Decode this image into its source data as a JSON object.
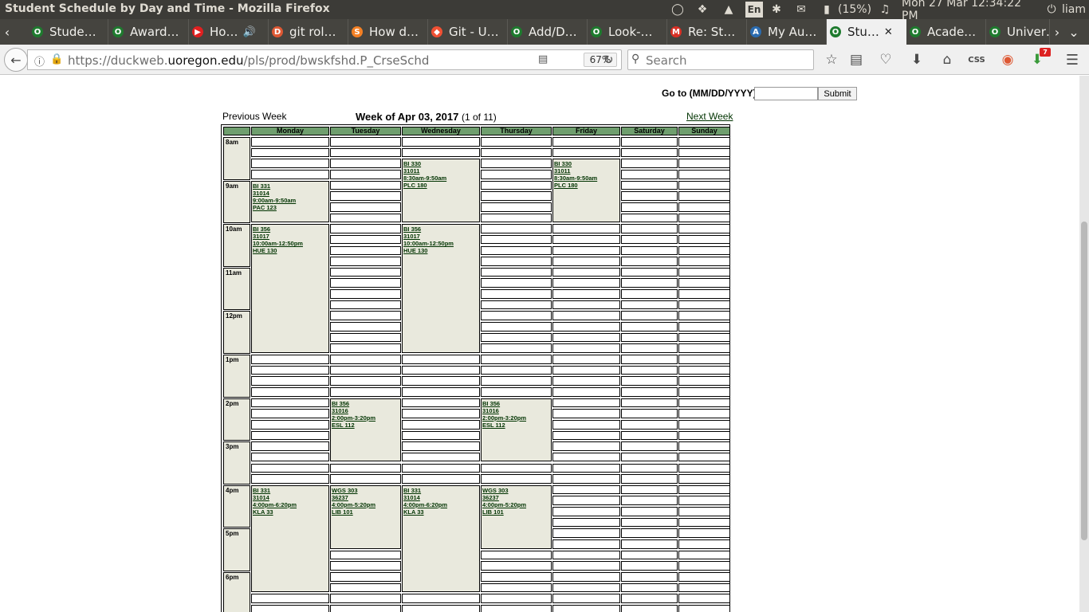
{
  "window": {
    "title": "Student Schedule by Day and Time - Mozilla Firefox"
  },
  "tray": {
    "lang": "En",
    "battery": "(15%)",
    "clock": "Mon 27 Mar 12:34:22 PM",
    "user": "liam",
    "icons": [
      "lightbulb-icon",
      "dropbox-icon",
      "wifi-icon",
      "keyboard-lang-icon",
      "bluetooth-icon",
      "mail-icon",
      "battery-icon",
      "volume-icon",
      "power-icon"
    ]
  },
  "tabs": [
    {
      "label": "Stude…",
      "favicon": "O",
      "favcolor": "#1e7b2e",
      "active": false
    },
    {
      "label": "Award…",
      "favicon": "O",
      "favcolor": "#1e7b2e",
      "active": false
    },
    {
      "label": "Ho…",
      "favicon": "▶",
      "favcolor": "#e02020",
      "active": false,
      "extra": "🔊"
    },
    {
      "label": "git rol…",
      "favicon": "D",
      "favcolor": "#de5833",
      "active": false
    },
    {
      "label": "How d…",
      "favicon": "S",
      "favcolor": "#f48024",
      "active": false
    },
    {
      "label": "Git - U…",
      "favicon": "◆",
      "favcolor": "#f05033",
      "active": false
    },
    {
      "label": "Add/D…",
      "favicon": "O",
      "favcolor": "#1e7b2e",
      "active": false
    },
    {
      "label": "Look-…",
      "favicon": "O",
      "favcolor": "#1e7b2e",
      "active": false
    },
    {
      "label": "Re: St…",
      "favicon": "M",
      "favcolor": "#d93025",
      "active": false
    },
    {
      "label": "My Au…",
      "favicon": "A",
      "favcolor": "#2b6cb0",
      "active": false
    },
    {
      "label": "Stu…",
      "favicon": "O",
      "favcolor": "#1e7b2e",
      "active": true,
      "extra": "✕"
    },
    {
      "label": "Acade…",
      "favicon": "O",
      "favcolor": "#1e7b2e",
      "active": false
    },
    {
      "label": "Univer…",
      "favicon": "O",
      "favcolor": "#1e7b2e",
      "active": false
    }
  ],
  "nav": {
    "url_prefix": "https://duckweb.",
    "url_domain": "uoregon.edu",
    "url_path": "/pls/prod/bwskfshd.P_CrseSchd",
    "zoom": "67%",
    "search_placeholder": "Search",
    "download_badge": "7"
  },
  "page": {
    "goto_label": "Go to (MM/DD/YYYY):",
    "goto_value": "",
    "submit_label": "Submit",
    "prev_week": "Previous Week",
    "week_title": "Week of Apr 03, 2017",
    "week_count": "(1 of 11)",
    "next_week": "Next Week"
  },
  "schedule": {
    "days": [
      "Monday",
      "Tuesday",
      "Wednesday",
      "Thursday",
      "Friday",
      "Saturday",
      "Sunday"
    ],
    "hours": [
      "8am",
      "9am",
      "10am",
      "11am",
      "12pm",
      "1pm",
      "2pm",
      "3pm",
      "4pm",
      "5pm",
      "6pm"
    ],
    "events": [
      {
        "day": 2,
        "start": 8.5,
        "end": 9.833,
        "lines": [
          "BI 330",
          "31011",
          "8:30am-9:50am",
          "PLC 180"
        ]
      },
      {
        "day": 4,
        "start": 8.5,
        "end": 9.833,
        "lines": [
          "BI 330",
          "31011",
          "8:30am-9:50am",
          "PLC 180"
        ]
      },
      {
        "day": 0,
        "start": 9.0,
        "end": 9.833,
        "lines": [
          "BI 331",
          "31014",
          "9:00am-9:50am",
          "PAC 123"
        ]
      },
      {
        "day": 0,
        "start": 10.0,
        "end": 12.833,
        "lines": [
          "BI 356",
          "31017",
          "10:00am-12:50pm",
          "HUE 130"
        ]
      },
      {
        "day": 2,
        "start": 10.0,
        "end": 12.833,
        "lines": [
          "BI 356",
          "31017",
          "10:00am-12:50pm",
          "HUE 130"
        ]
      },
      {
        "day": 1,
        "start": 14.0,
        "end": 15.333,
        "lines": [
          "BI 356",
          "31016",
          "2:00pm-3:20pm",
          "ESL 112"
        ]
      },
      {
        "day": 3,
        "start": 14.0,
        "end": 15.333,
        "lines": [
          "BI 356",
          "31016",
          "2:00pm-3:20pm",
          "ESL 112"
        ]
      },
      {
        "day": 0,
        "start": 16.0,
        "end": 18.333,
        "lines": [
          "BI 331",
          "31014",
          "4:00pm-6:20pm",
          "KLA 33"
        ]
      },
      {
        "day": 2,
        "start": 16.0,
        "end": 18.333,
        "lines": [
          "BI 331",
          "31014",
          "4:00pm-6:20pm",
          "KLA 33"
        ]
      },
      {
        "day": 1,
        "start": 16.0,
        "end": 17.333,
        "lines": [
          "WGS 303",
          "36237",
          "4:00pm-5:20pm",
          "LIB 101"
        ]
      },
      {
        "day": 3,
        "start": 16.0,
        "end": 17.333,
        "lines": [
          "WGS 303",
          "36237",
          "4:00pm-5:20pm",
          "LIB 101"
        ]
      }
    ]
  }
}
